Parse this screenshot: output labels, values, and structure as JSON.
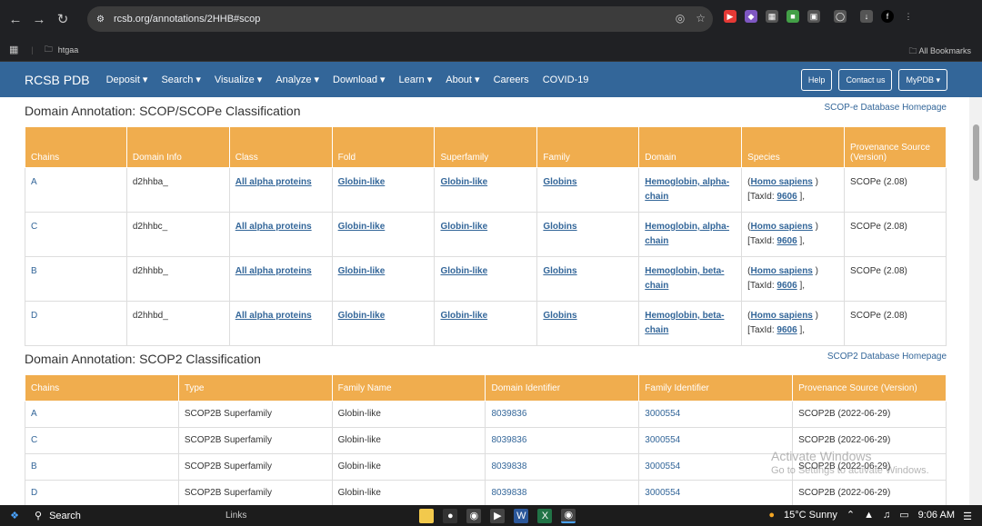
{
  "browser": {
    "url": "rcsb.org/annotations/2HHB#scop",
    "bookmark_folder": "htgaa",
    "all_bookmarks": "All Bookmarks",
    "profile_initial": "f"
  },
  "nav": {
    "brand": "RCSB PDB",
    "items": [
      "Deposit ▾",
      "Search ▾",
      "Visualize ▾",
      "Analyze ▾",
      "Download ▾",
      "Learn ▾",
      "About ▾",
      "Careers",
      "COVID-19"
    ],
    "help": "Help",
    "contact": "Contact us",
    "mypdb": "MyPDB ▾"
  },
  "scope": {
    "title": "Domain Annotation: SCOP/SCOPe Classification",
    "homepage": "SCOP-e Database Homepage",
    "headers": [
      "Chains",
      "Domain Info",
      "Class",
      "Fold",
      "Superfamily",
      "Family",
      "Domain",
      "Species",
      "Provenance Source (Version)"
    ],
    "rows": [
      {
        "chain": "A",
        "info": "d2hhba_",
        "cls": "All alpha proteins",
        "fold": "Globin-like",
        "sf": "Globin-like",
        "fam": "Globins",
        "domain": "Hemoglobin, alpha-chain",
        "species": "Homo sapiens",
        "taxid": "9606",
        "prov": "SCOPe (2.08)"
      },
      {
        "chain": "C",
        "info": "d2hhbc_",
        "cls": "All alpha proteins",
        "fold": "Globin-like",
        "sf": "Globin-like",
        "fam": "Globins",
        "domain": "Hemoglobin, alpha-chain",
        "species": "Homo sapiens",
        "taxid": "9606",
        "prov": "SCOPe (2.08)"
      },
      {
        "chain": "B",
        "info": "d2hhbb_",
        "cls": "All alpha proteins",
        "fold": "Globin-like",
        "sf": "Globin-like",
        "fam": "Globins",
        "domain": "Hemoglobin, beta-chain",
        "species": "Homo sapiens",
        "taxid": "9606",
        "prov": "SCOPe (2.08)"
      },
      {
        "chain": "D",
        "info": "d2hhbd_",
        "cls": "All alpha proteins",
        "fold": "Globin-like",
        "sf": "Globin-like",
        "fam": "Globins",
        "domain": "Hemoglobin, beta-chain",
        "species": "Homo sapiens",
        "taxid": "9606",
        "prov": "SCOPe (2.08)"
      }
    ],
    "taxid_label": "[TaxId:",
    "taxid_close": "],"
  },
  "scop2": {
    "title": "Domain Annotation: SCOP2 Classification",
    "homepage": "SCOP2 Database Homepage",
    "headers": [
      "Chains",
      "Type",
      "Family Name",
      "Domain Identifier",
      "Family Identifier",
      "Provenance Source (Version)"
    ],
    "rows": [
      {
        "chain": "A",
        "type": "SCOP2B Superfamily",
        "fam": "Globin-like",
        "domid": "8039836",
        "famid": "3000554",
        "prov": "SCOP2B (2022-06-29)"
      },
      {
        "chain": "C",
        "type": "SCOP2B Superfamily",
        "fam": "Globin-like",
        "domid": "8039836",
        "famid": "3000554",
        "prov": "SCOP2B (2022-06-29)"
      },
      {
        "chain": "B",
        "type": "SCOP2B Superfamily",
        "fam": "Globin-like",
        "domid": "8039838",
        "famid": "3000554",
        "prov": "SCOP2B (2022-06-29)"
      },
      {
        "chain": "D",
        "type": "SCOP2B Superfamily",
        "fam": "Globin-like",
        "domid": "8039838",
        "famid": "3000554",
        "prov": "SCOP2B (2022-06-29)"
      }
    ]
  },
  "watermark": {
    "line1": "Activate Windows",
    "line2": "Go to Settings to activate Windows."
  },
  "taskbar": {
    "search": "Search",
    "links": "Links",
    "weather": "15°C  Sunny",
    "time": "9:06 AM"
  }
}
